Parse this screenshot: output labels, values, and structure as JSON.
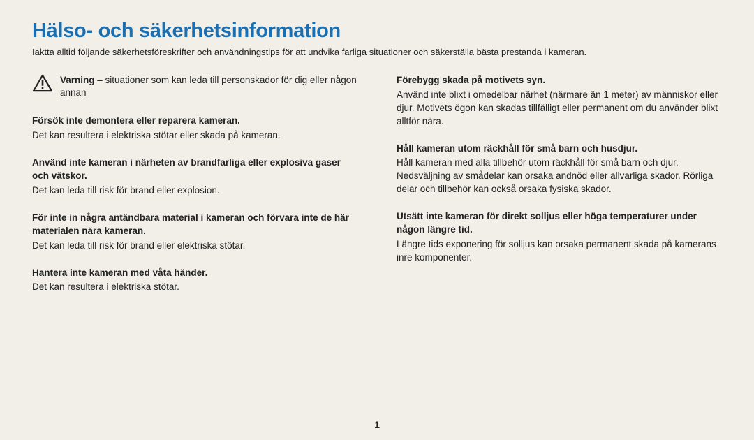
{
  "page": {
    "title": "Hälso- och säkerhetsinformation",
    "intro": "Iaktta alltid följande säkerhetsföreskrifter och användningstips för att undvika farliga situationer och säkerställa bästa prestanda i kameran.",
    "number": "1"
  },
  "warning": {
    "label": "Varning",
    "text": " – situationer som kan leda till personskador för dig eller någon annan"
  },
  "left": [
    {
      "heading": "Försök inte demontera eller reparera kameran.",
      "body": "Det kan resultera i elektriska stötar eller skada på kameran."
    },
    {
      "heading": "Använd inte kameran i närheten av brandfarliga eller explosiva gaser och vätskor.",
      "body": "Det kan leda till risk för brand eller explosion."
    },
    {
      "heading": "För inte in några antändbara material i kameran och förvara inte de här materialen nära kameran.",
      "body": "Det kan leda till risk för brand eller elektriska stötar."
    },
    {
      "heading": "Hantera inte kameran med våta händer.",
      "body": "Det kan resultera i elektriska stötar."
    }
  ],
  "right": [
    {
      "heading": "Förebygg skada på motivets syn.",
      "body": "Använd inte blixt i omedelbar närhet (närmare än 1 meter) av människor eller djur. Motivets ögon kan skadas tillfälligt eller permanent om du använder blixt alltför nära."
    },
    {
      "heading": "Håll kameran utom räckhåll för små barn och husdjur.",
      "body": "Håll kameran med alla tillbehör utom räckhåll för små barn och djur. Nedsväljning av smådelar kan orsaka andnöd eller allvarliga skador. Rörliga delar och tillbehör kan också orsaka fysiska skador."
    },
    {
      "heading": "Utsätt inte kameran för direkt solljus eller höga temperaturer under någon längre tid.",
      "body": "Längre tids exponering för solljus kan orsaka permanent skada på kamerans inre komponenter."
    }
  ]
}
